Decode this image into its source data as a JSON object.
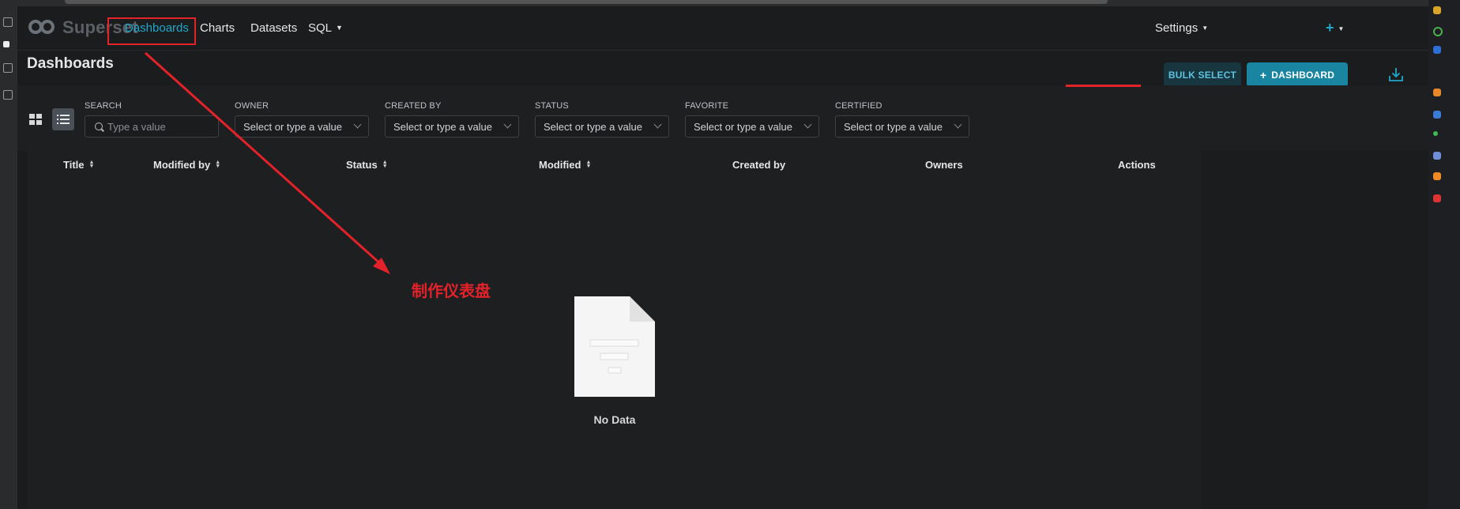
{
  "navbar": {
    "logo_text": "Superset",
    "items": [
      {
        "label": "Dashboards",
        "active": true
      },
      {
        "label": "Charts"
      },
      {
        "label": "Datasets"
      },
      {
        "label": "SQL"
      }
    ],
    "plus_icon": "plus-icon",
    "settings_label": "Settings"
  },
  "header": {
    "title": "Dashboards",
    "bulk_select_label": "BULK SELECT",
    "add_dashboard_label": "DASHBOARD",
    "download_icon": "download-icon"
  },
  "filters": {
    "search": {
      "label": "SEARCH",
      "placeholder": "Type a value"
    },
    "owner": {
      "label": "OWNER",
      "placeholder": "Select or type a value"
    },
    "created_by": {
      "label": "CREATED BY",
      "placeholder": "Select or type a value"
    },
    "status": {
      "label": "STATUS",
      "placeholder": "Select or type a value"
    },
    "favorite": {
      "label": "FAVORITE",
      "placeholder": "Select or type a value"
    },
    "certified": {
      "label": "CERTIFIED",
      "placeholder": "Select or type a value"
    }
  },
  "table": {
    "columns": [
      "Title",
      "Modified by",
      "Status",
      "Modified",
      "Created by",
      "Owners",
      "Actions"
    ],
    "empty_text": "No Data"
  },
  "annotation": {
    "text": "制作仪表盘",
    "color": "#e3222a"
  },
  "colors": {
    "accent": "#20a7c9",
    "primary_button": "#1a85a0",
    "background": "#1b1c1e"
  }
}
